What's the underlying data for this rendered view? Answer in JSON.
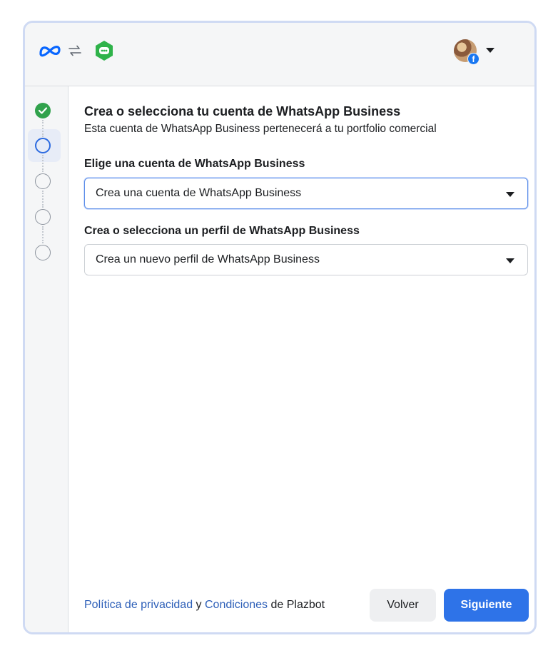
{
  "header": {
    "logo_icon": "meta-logo-icon",
    "swap_icon": "swap-arrows-icon",
    "app_icon": "chatbot-hexagon-icon",
    "avatar_badge": "f"
  },
  "stepper": {
    "steps": [
      {
        "state": "done"
      },
      {
        "state": "current"
      },
      {
        "state": "todo"
      },
      {
        "state": "todo"
      },
      {
        "state": "todo"
      }
    ]
  },
  "main": {
    "title": "Crea o selecciona tu cuenta de WhatsApp Business",
    "subtitle": "Esta cuenta de WhatsApp Business pertenecerá a tu portfolio comercial",
    "account_label": "Elige una cuenta de WhatsApp Business",
    "account_value": "Crea una cuenta de WhatsApp Business",
    "profile_label": "Crea o selecciona un perfil de WhatsApp Business",
    "profile_value": "Crea un nuevo perfil de WhatsApp Business"
  },
  "footer": {
    "privacy_link": "Política de privacidad",
    "and_text": " y ",
    "terms_link": "Condiciones",
    "owner_text": " de Plazbot",
    "back_label": "Volver",
    "next_label": "Siguiente"
  },
  "colors": {
    "accent": "#2e73e8",
    "success": "#31a24c",
    "frame_border": "#cfdaf3"
  }
}
